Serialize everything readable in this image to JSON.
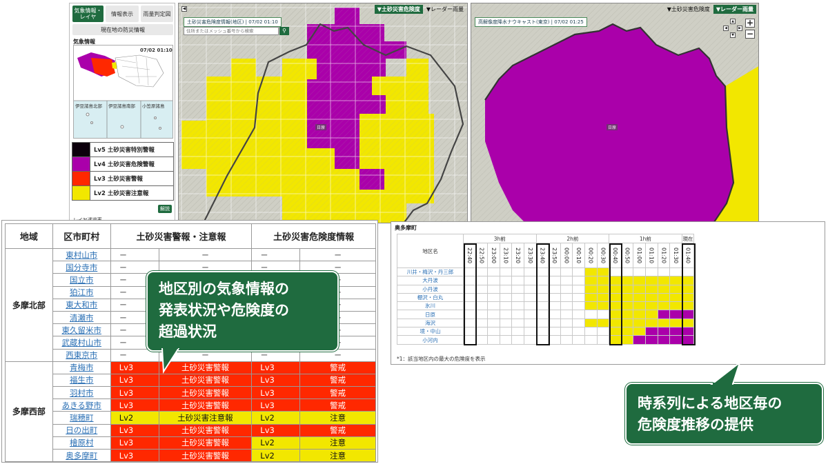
{
  "sidebar": {
    "tabs": [
      "気象情報・レイヤ",
      "情報表示",
      "雨量判定図"
    ],
    "current_button": "現在地の防災情報",
    "wx_title": "気象情報",
    "minimap_time": "07/02 01:10",
    "minimap_labels": [
      "伊豆諸島北部",
      "伊豆諸島南部",
      "小笠原諸島"
    ],
    "legend": [
      {
        "label": "Lv5 土砂災害特別警報",
        "color": "#0c000c"
      },
      {
        "label": "Lv4 土砂災害危険警報",
        "color": "#aa00aa"
      },
      {
        "label": "Lv3 土砂災害警報",
        "color": "#ff2800"
      },
      {
        "label": "Lv2 土砂災害注意報",
        "color": "#f2e700"
      }
    ],
    "legend_button": "解説",
    "layer_label": "レイヤ透過率"
  },
  "map_left": {
    "header_toggle": "▼土砂災害危険度",
    "header_radar": "▼レーダー雨量",
    "info": "土砂災害危険度情報(地区) | 07/02 01:10",
    "search_placeholder": "住所またはメッシュ番号から検索",
    "place": "日原"
  },
  "map_right": {
    "header_toggle": "▼土砂災害危険度",
    "header_radar": "▼レーダー雨量",
    "info": "高解像度降水ナウキャスト(東京) | 07/02 01:25",
    "place": "日原"
  },
  "table": {
    "headers": [
      "地域",
      "区市町村",
      "土砂災害警報・注意報",
      "土砂災害危険度情報"
    ],
    "regions": [
      {
        "name": "多摩北部",
        "rows": [
          {
            "city": "東村山市",
            "w1": "－",
            "w2": "－",
            "r1": "－",
            "r2": "－",
            "cls": ""
          },
          {
            "city": "国分寺市",
            "w1": "－",
            "w2": "－",
            "r1": "－",
            "r2": "－",
            "cls": ""
          },
          {
            "city": "国立市",
            "w1": "－",
            "w2": "－",
            "r1": "－",
            "r2": "－",
            "cls": ""
          },
          {
            "city": "狛江市",
            "w1": "－",
            "w2": "－",
            "r1": "－",
            "r2": "－",
            "cls": ""
          },
          {
            "city": "東大和市",
            "w1": "－",
            "w2": "－",
            "r1": "－",
            "r2": "－",
            "cls": ""
          },
          {
            "city": "清瀬市",
            "w1": "－",
            "w2": "－",
            "r1": "－",
            "r2": "－",
            "cls": ""
          },
          {
            "city": "東久留米市",
            "w1": "－",
            "w2": "－",
            "r1": "－",
            "r2": "－",
            "cls": ""
          },
          {
            "city": "武蔵村山市",
            "w1": "－",
            "w2": "－",
            "r1": "－",
            "r2": "－",
            "cls": ""
          },
          {
            "city": "西東京市",
            "w1": "－",
            "w2": "－",
            "r1": "－",
            "r2": "－",
            "cls": ""
          }
        ]
      },
      {
        "name": "多摩西部",
        "rows": [
          {
            "city": "青梅市",
            "w1": "Lv3",
            "w2": "土砂災害警報",
            "r1": "Lv3",
            "r2": "警戒",
            "cls": "lv3",
            "rcls": "lv3"
          },
          {
            "city": "福生市",
            "w1": "Lv3",
            "w2": "土砂災害警報",
            "r1": "Lv3",
            "r2": "警戒",
            "cls": "lv3",
            "rcls": "lv3"
          },
          {
            "city": "羽村市",
            "w1": "Lv3",
            "w2": "土砂災害警報",
            "r1": "Lv3",
            "r2": "警戒",
            "cls": "lv3",
            "rcls": "lv3"
          },
          {
            "city": "あきる野市",
            "w1": "Lv3",
            "w2": "土砂災害警報",
            "r1": "Lv3",
            "r2": "警戒",
            "cls": "lv3",
            "rcls": "lv3"
          },
          {
            "city": "瑞穂町",
            "w1": "Lv2",
            "w2": "土砂災害注意報",
            "r1": "Lv2",
            "r2": "注意",
            "cls": "lv2",
            "rcls": "lv2"
          },
          {
            "city": "日の出町",
            "w1": "Lv3",
            "w2": "土砂災害警報",
            "r1": "Lv3",
            "r2": "警戒",
            "cls": "lv3",
            "rcls": "lv3"
          },
          {
            "city": "檜原村",
            "w1": "Lv3",
            "w2": "土砂災害警報",
            "r1": "Lv2",
            "r2": "注意",
            "cls": "lv3",
            "rcls": "lv2"
          },
          {
            "city": "奥多摩町",
            "w1": "Lv3",
            "w2": "土砂災害警報",
            "r1": "Lv2",
            "r2": "注意",
            "cls": "lv3",
            "rcls": "lv2"
          }
        ]
      }
    ]
  },
  "timeseries": {
    "title": "奥多摩町",
    "area_header": "地区名",
    "groups": [
      "3h前",
      "2h前",
      "1h前",
      "現在"
    ],
    "times": [
      "22:40",
      "22:50",
      "23:00",
      "23:10",
      "23:20",
      "23:30",
      "23:40",
      "23:50",
      "00:00",
      "00:10",
      "00:20",
      "00:30",
      "00:40",
      "00:50",
      "01:00",
      "01:10",
      "01:20",
      "01:30",
      "01:40"
    ],
    "areas": [
      "川井・梅沢・丹三郎",
      "大丹波",
      "小丹波",
      "棚沢・白丸",
      "氷川",
      "日原",
      "海沢",
      "境・中山",
      "小河内"
    ],
    "levels": [
      "0000000000110000000",
      "0000000000111111111",
      "0000000000111111111",
      "0000000000111111111",
      "0000000000111111111",
      "0000000000001111222",
      "0000000000111111111",
      "0000000000001112222",
      "0000000000001122222"
    ],
    "note": "*1：該当地区内の最大の危険度を表示"
  },
  "callouts": {
    "left": [
      "地区別の気象情報の",
      "発表状況や危険度の",
      "超過状況"
    ],
    "right": [
      "時系列による地区毎の",
      "危険度推移の提供"
    ]
  },
  "colors": {
    "brand": "#1f6b3f",
    "lv4": "#aa00aa",
    "lv3": "#ff2800",
    "lv2": "#f2e700"
  }
}
